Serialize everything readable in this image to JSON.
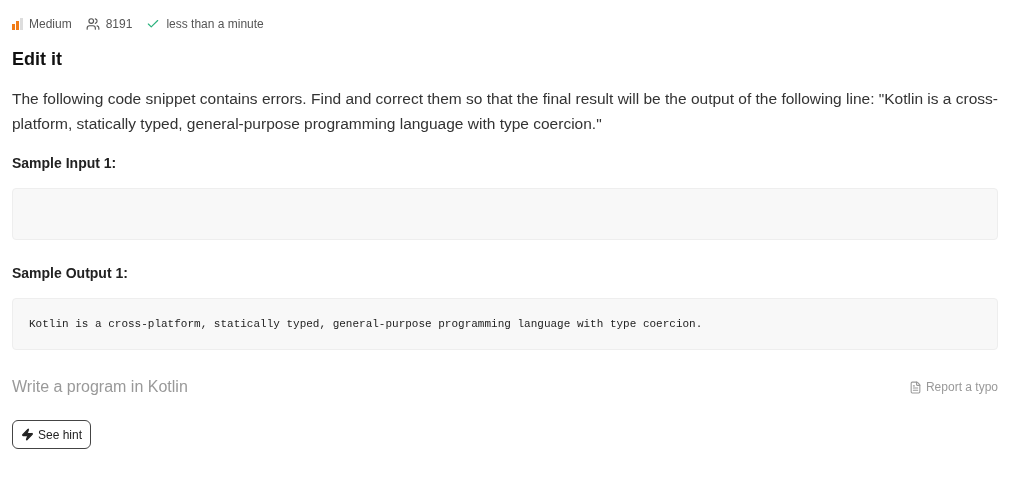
{
  "meta": {
    "difficulty": {
      "label": "Medium",
      "level": 0.67
    },
    "solvers": "8191",
    "time": "less than a minute"
  },
  "title": "Edit it",
  "description": "The following code snippet contains errors. Find and correct them so that the final result will be the output of the following line: \"Kotlin is a cross-platform, statically typed, general-purpose programming language with type coercion.\"",
  "samples": [
    {
      "label": "Sample Input 1:"
    },
    {
      "label": "Sample Output 1:",
      "content": "Kotlin is a cross-platform, statically typed, general-purpose programming language with type coercion."
    }
  ],
  "editor_prompt": "Write a program in Kotlin",
  "report_link": "Report a typo",
  "hint_button": "See hint"
}
